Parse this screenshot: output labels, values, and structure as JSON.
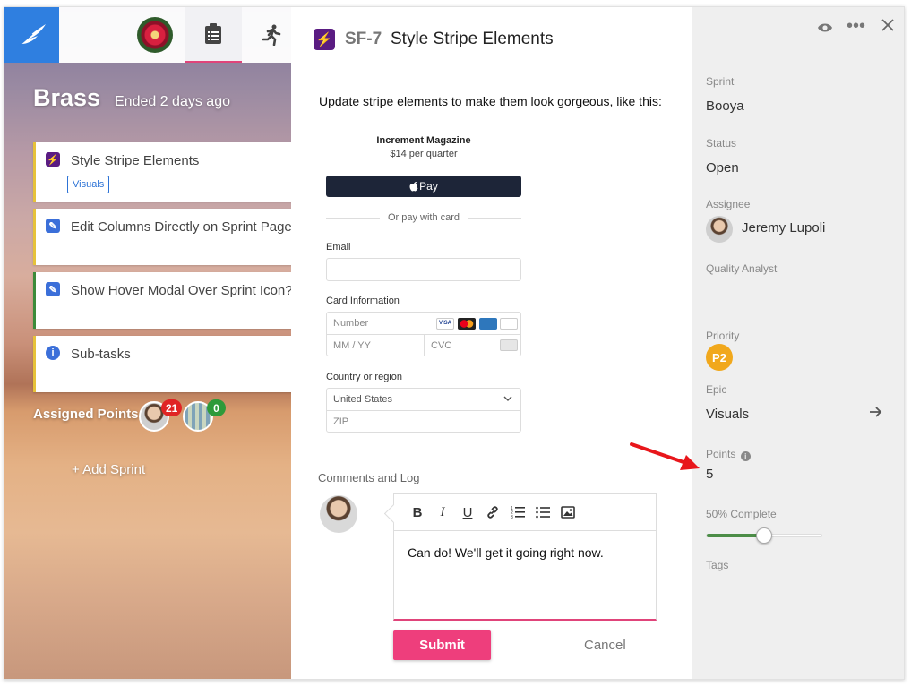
{
  "sidebar": {
    "sprint_name": "Brass",
    "sprint_status": "Ended 2 days ago",
    "cards": [
      {
        "title": "Style Stripe Elements",
        "tag": "Visuals",
        "icon": "lightning-icon"
      },
      {
        "title": "Edit Columns Directly on Sprint Page",
        "icon": "pencil-icon"
      },
      {
        "title": "Show Hover Modal Over Sprint Icon?",
        "icon": "pencil-icon"
      },
      {
        "title": "Sub-tasks",
        "icon": "info-icon"
      }
    ],
    "assigned_label": "Assigned Points:",
    "assigned_points": [
      {
        "count": "21",
        "color": "#e02424"
      },
      {
        "count": "0",
        "color": "#2e9a3a"
      }
    ],
    "add_sprint": "+ Add Sprint"
  },
  "task": {
    "key": "SF-7",
    "title": "Style Stripe Elements",
    "description": "Update stripe elements to make them look gorgeous, like this:"
  },
  "stripe_form": {
    "product_name": "Increment Magazine",
    "product_price": "$14 per quarter",
    "apple_pay_label": " Pay",
    "or_pay_label": "Or pay with card",
    "email_label": "Email",
    "card_info_label": "Card Information",
    "number_placeholder": "Number",
    "expiry_placeholder": "MM / YY",
    "cvc_placeholder": "CVC",
    "country_label": "Country or region",
    "country_value": "United States",
    "zip_placeholder": "ZIP"
  },
  "comments": {
    "label": "Comments and Log",
    "text": "Can do!  We'll get it going right now.",
    "submit_label": "Submit",
    "cancel_label": "Cancel"
  },
  "details": {
    "sprint_label": "Sprint",
    "sprint_value": "Booya",
    "status_label": "Status",
    "status_value": "Open",
    "assignee_label": "Assignee",
    "assignee_value": "Jeremy Lupoli",
    "qa_label": "Quality Analyst",
    "priority_label": "Priority",
    "priority_value": "P2",
    "epic_label": "Epic",
    "epic_value": "Visuals",
    "points_label": "Points",
    "points_value": "5",
    "complete_label": "50% Complete",
    "complete_fraction": 0.5,
    "tags_label": "Tags"
  },
  "colors": {
    "accent": "#ee3e7c",
    "brand": "#2f7fe0",
    "epic_purple": "#5a1c82",
    "priority": "#f1a81c",
    "progress": "#4c8d47",
    "annotation_arrow": "#e8161b"
  }
}
